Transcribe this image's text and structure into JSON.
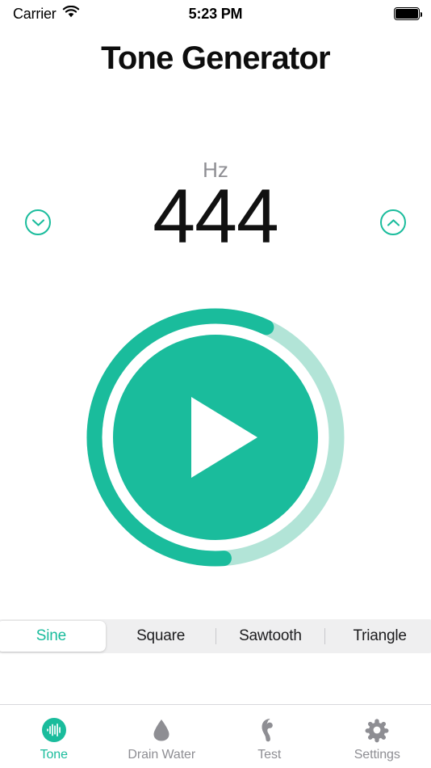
{
  "status_bar": {
    "carrier": "Carrier",
    "wifi_icon": "wifi-icon",
    "time": "5:23 PM",
    "battery_icon": "battery-full-icon"
  },
  "header": {
    "title": "Tone Generator"
  },
  "frequency": {
    "unit_label": "Hz",
    "value": "444",
    "decrease_icon": "chevron-down-circle-icon",
    "increase_icon": "chevron-up-circle-icon"
  },
  "player": {
    "play_icon": "play-triangle-icon",
    "progress_percent": 58,
    "track_color": "#B2E4D7",
    "progress_color": "#1ABC9C",
    "button_color": "#1ABC9C"
  },
  "waveforms": {
    "options": [
      {
        "label": "Sine",
        "selected": true
      },
      {
        "label": "Square",
        "selected": false
      },
      {
        "label": "Sawtooth",
        "selected": false
      },
      {
        "label": "Triangle",
        "selected": false
      }
    ]
  },
  "tabbar": {
    "items": [
      {
        "label": "Tone",
        "icon": "tone-waveform-icon",
        "active": true
      },
      {
        "label": "Drain Water",
        "icon": "water-drop-icon",
        "active": false
      },
      {
        "label": "Test",
        "icon": "ear-icon",
        "active": false
      },
      {
        "label": "Settings",
        "icon": "gear-icon",
        "active": false
      }
    ]
  },
  "colors": {
    "accent": "#1ABC9C",
    "accent_light": "#B2E4D7",
    "inactive": "#8E8E93",
    "segment_bg": "#EFEFF0"
  }
}
